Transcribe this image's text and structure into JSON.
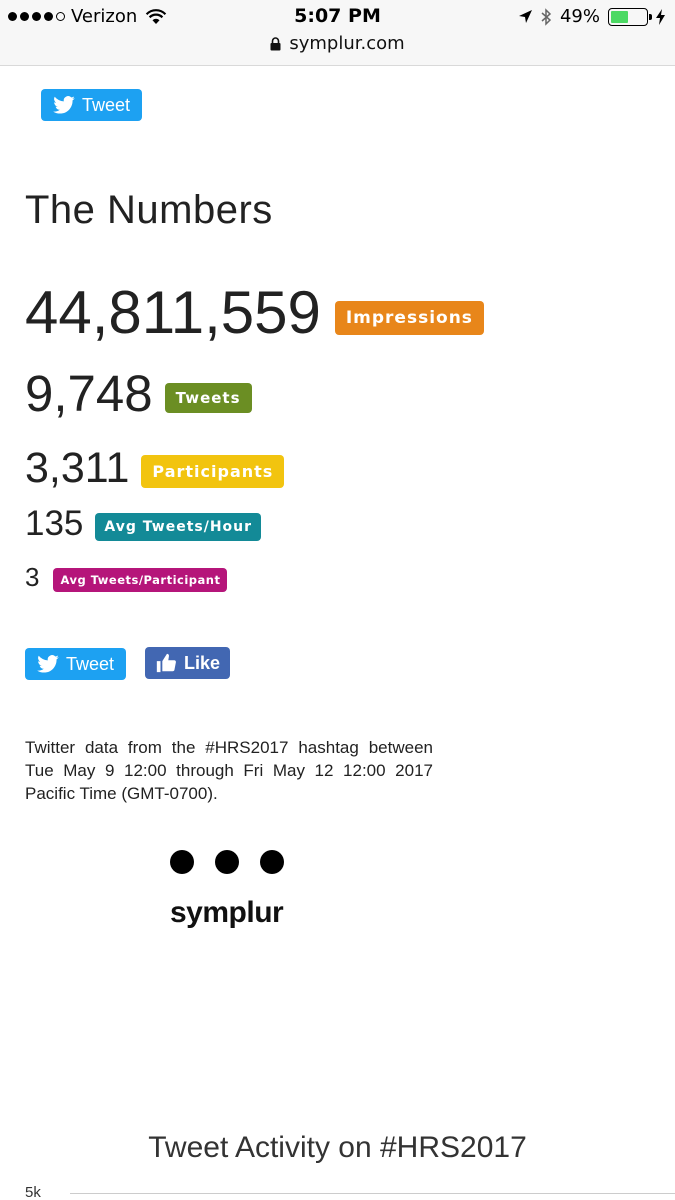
{
  "status_bar": {
    "carrier": "Verizon",
    "time": "5:07 PM",
    "url": "symplur.com",
    "battery": "49%",
    "battery_level": 0.49
  },
  "share_top": {
    "tweet_label": "Tweet"
  },
  "numbers": {
    "heading": "The Numbers",
    "stats": [
      {
        "value": "44,811,559",
        "label": "Impressions",
        "color": "#e8861a"
      },
      {
        "value": "9,748",
        "label": "Tweets",
        "color": "#6b8e23"
      },
      {
        "value": "3,311",
        "label": "Participants",
        "color": "#f2c40f"
      },
      {
        "value": "135",
        "label": "Avg Tweets/Hour",
        "color": "#138a97"
      },
      {
        "value": "3",
        "label": "Avg Tweets/Participant",
        "color": "#b5157a"
      }
    ]
  },
  "share_bottom": {
    "tweet_label": "Tweet",
    "like_label": "Like"
  },
  "description": "Twitter data from the #HRS2017 hashtag between Tue May 9 12:00 through Fri May 12 12:00 2017 Pacific Time (GMT-0700).",
  "logo": {
    "text": "symplur"
  },
  "activity": {
    "title": "Tweet Activity on #HRS2017",
    "y_tick": "5k"
  }
}
